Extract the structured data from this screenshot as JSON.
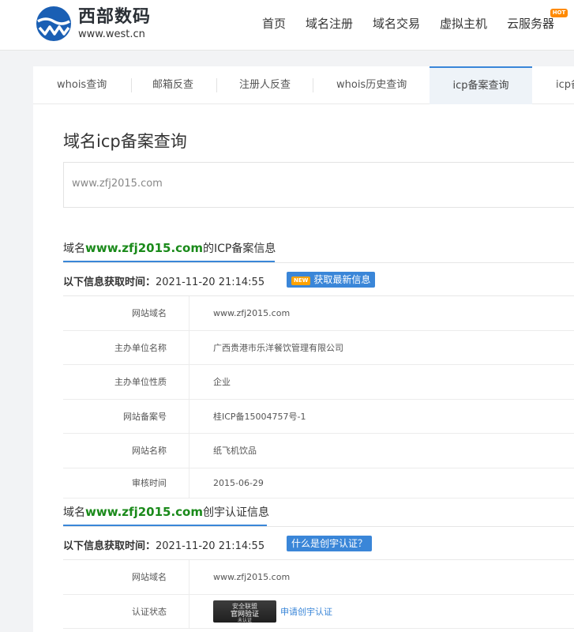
{
  "header": {
    "logo_name": "西部数码",
    "logo_url": "www.west.cn",
    "nav": [
      "首页",
      "域名注册",
      "域名交易",
      "虚拟主机",
      "云服务器"
    ],
    "hot_badge": "HOT",
    "colors": {
      "logo_blue": "#1a5fb4",
      "hot": "#ff8a00"
    }
  },
  "tabs": [
    {
      "label": "whois查询",
      "active": false
    },
    {
      "label": "邮箱反查",
      "active": false
    },
    {
      "label": "注册人反查",
      "active": false
    },
    {
      "label": "whois历史查询",
      "active": false
    },
    {
      "label": "icp备案查询",
      "active": true
    },
    {
      "label": "icp备",
      "active": false
    }
  ],
  "page": {
    "title": "域名icp备案查询",
    "search_value": "www.zfj2015.com"
  },
  "icp_section": {
    "title_prefix": "域名",
    "domain": "www.zfj2015.com",
    "title_suffix": "的ICP备案信息",
    "fetch_label": "以下信息获取时间：",
    "fetch_time": "2021-11-20 21:14:55",
    "new_badge": "NEW",
    "button": "获取最新信息",
    "rows": [
      {
        "label": "网站域名",
        "value": "www.zfj2015.com"
      },
      {
        "label": "主办单位名称",
        "value": "广西贵港市乐洋餐饮管理有限公司"
      },
      {
        "label": "主办单位性质",
        "value": "企业"
      },
      {
        "label": "网站备案号",
        "value": "桂ICP备15004757号-1"
      },
      {
        "label": "网站名称",
        "value": "纸飞机饮品"
      },
      {
        "label": "审核时间",
        "value": "2015-06-29"
      }
    ]
  },
  "cy_section": {
    "title_prefix": "域名",
    "domain": "www.zfj2015.com",
    "title_suffix": "创宇认证信息",
    "fetch_label": "以下信息获取时间：",
    "fetch_time": "2021-11-20 21:14:55",
    "button": "什么是创宇认证？",
    "rows": [
      {
        "label": "网站域名",
        "value": "www.zfj2015.com"
      },
      {
        "label": "认证状态",
        "value": "申请创宇认证"
      }
    ],
    "cert_image_text": [
      "安全联盟",
      "官网验证",
      "未认证"
    ]
  }
}
